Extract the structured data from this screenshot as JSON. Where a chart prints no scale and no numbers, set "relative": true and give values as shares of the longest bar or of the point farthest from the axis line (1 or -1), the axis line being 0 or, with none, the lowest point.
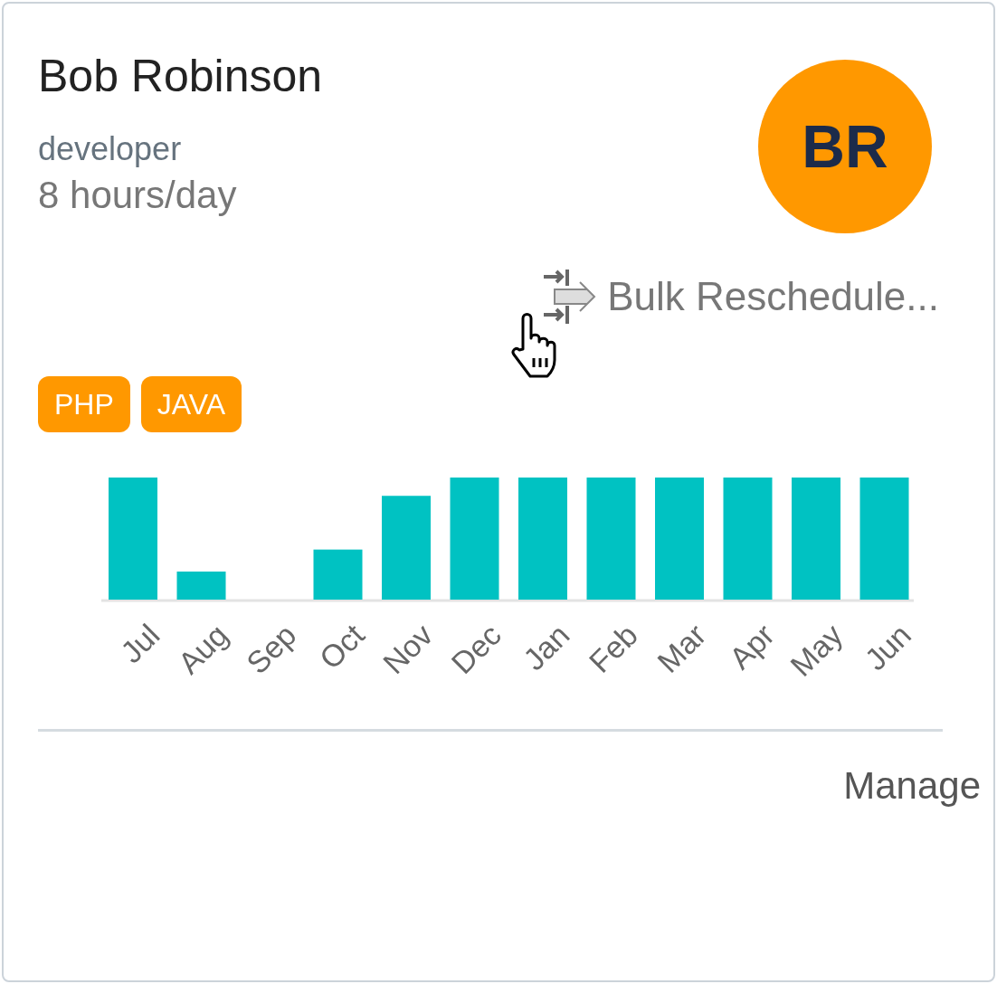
{
  "person": {
    "name": "Bob Robinson",
    "role": "developer",
    "capacity": "8 hours/day",
    "initials": "BR"
  },
  "action": {
    "label": "Bulk Reschedule..."
  },
  "tags": [
    {
      "label": "PHP"
    },
    {
      "label": "JAVA"
    }
  ],
  "chart_data": {
    "type": "bar",
    "categories": [
      "Jul",
      "Aug",
      "Sep",
      "Oct",
      "Nov",
      "Dec",
      "Jan",
      "Feb",
      "Mar",
      "Apr",
      "May",
      "Jun"
    ],
    "relative": true,
    "series": [
      {
        "color": "#00c2c2",
        "values": [
          1,
          0.23,
          0,
          0.41,
          0.85,
          1,
          1,
          1,
          1,
          1,
          1,
          1
        ]
      }
    ]
  },
  "footer": {
    "link": "Manage"
  }
}
